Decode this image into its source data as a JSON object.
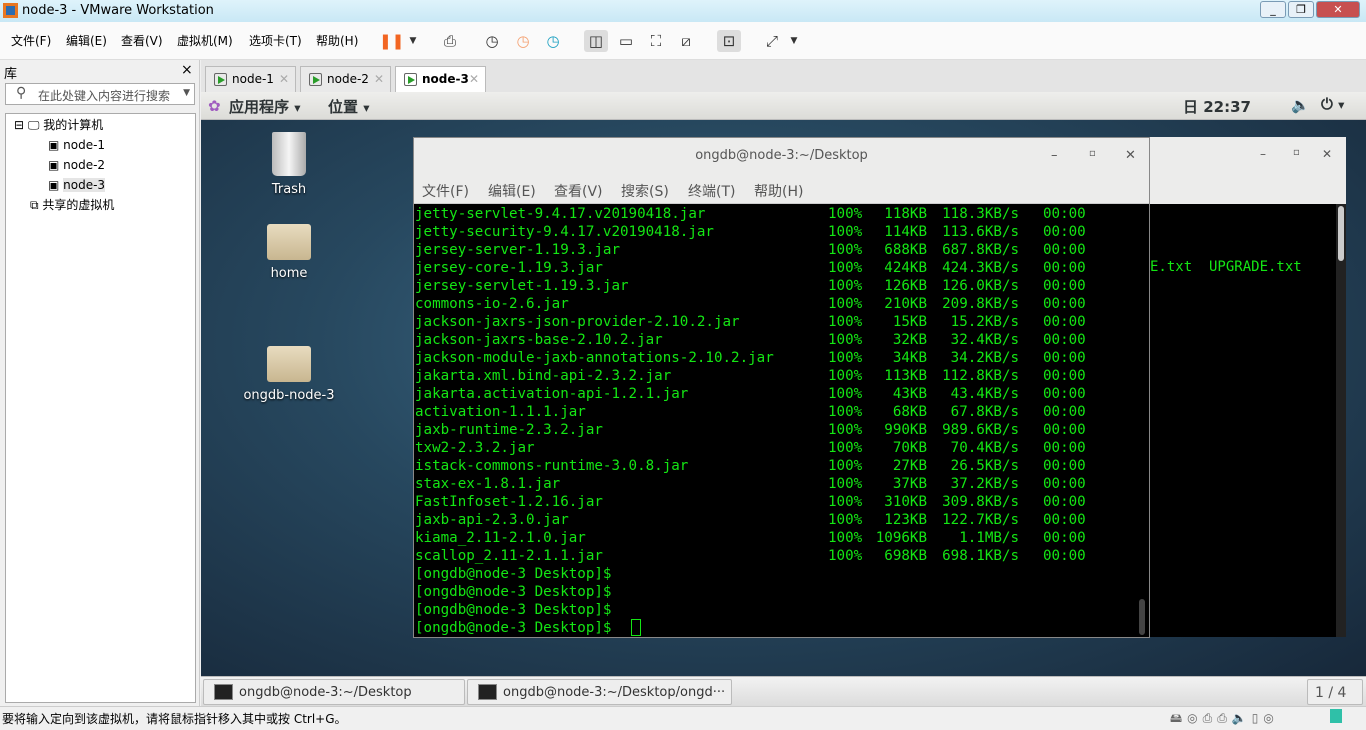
{
  "window": {
    "title": "node-3 - VMware Workstation"
  },
  "menubar": {
    "items": [
      "文件(F)",
      "编辑(E)",
      "查看(V)",
      "虚拟机(M)",
      "选项卡(T)",
      "帮助(H)"
    ]
  },
  "library": {
    "title": "库",
    "close": "×",
    "search_placeholder": "在此处键入内容进行搜索",
    "tree": {
      "root": "我的计算机",
      "vms": [
        "node-1",
        "node-2",
        "node-3"
      ],
      "shared": "共享的虚拟机"
    }
  },
  "vm_tabs": [
    {
      "label": "node-1"
    },
    {
      "label": "node-2"
    },
    {
      "label": "node-3",
      "active": true
    }
  ],
  "gnome": {
    "apps": "应用程序",
    "places": "位置",
    "clock": "日 22:37"
  },
  "desktop": {
    "icons": [
      "Trash",
      "home",
      "ongdb-node-3"
    ]
  },
  "terminal": {
    "title": "ongdb@node-3:~/Desktop",
    "menu": [
      "文件(F)",
      "编辑(E)",
      "查看(V)",
      "搜索(S)",
      "终端(T)",
      "帮助(H)"
    ],
    "transfers": [
      [
        "jetty-servlet-9.4.17.v20190418.jar",
        "100%",
        "118KB",
        "118.3KB/s",
        "00:00"
      ],
      [
        "jetty-security-9.4.17.v20190418.jar",
        "100%",
        "114KB",
        "113.6KB/s",
        "00:00"
      ],
      [
        "jersey-server-1.19.3.jar",
        "100%",
        "688KB",
        "687.8KB/s",
        "00:00"
      ],
      [
        "jersey-core-1.19.3.jar",
        "100%",
        "424KB",
        "424.3KB/s",
        "00:00"
      ],
      [
        "jersey-servlet-1.19.3.jar",
        "100%",
        "126KB",
        "126.0KB/s",
        "00:00"
      ],
      [
        "commons-io-2.6.jar",
        "100%",
        "210KB",
        "209.8KB/s",
        "00:00"
      ],
      [
        "jackson-jaxrs-json-provider-2.10.2.jar",
        "100%",
        "15KB",
        "15.2KB/s",
        "00:00"
      ],
      [
        "jackson-jaxrs-base-2.10.2.jar",
        "100%",
        "32KB",
        "32.4KB/s",
        "00:00"
      ],
      [
        "jackson-module-jaxb-annotations-2.10.2.jar",
        "100%",
        "34KB",
        "34.2KB/s",
        "00:00"
      ],
      [
        "jakarta.xml.bind-api-2.3.2.jar",
        "100%",
        "113KB",
        "112.8KB/s",
        "00:00"
      ],
      [
        "jakarta.activation-api-1.2.1.jar",
        "100%",
        "43KB",
        "43.4KB/s",
        "00:00"
      ],
      [
        "activation-1.1.1.jar",
        "100%",
        "68KB",
        "67.8KB/s",
        "00:00"
      ],
      [
        "jaxb-runtime-2.3.2.jar",
        "100%",
        "990KB",
        "989.6KB/s",
        "00:00"
      ],
      [
        "txw2-2.3.2.jar",
        "100%",
        "70KB",
        "70.4KB/s",
        "00:00"
      ],
      [
        "istack-commons-runtime-3.0.8.jar",
        "100%",
        "27KB",
        "26.5KB/s",
        "00:00"
      ],
      [
        "stax-ex-1.8.1.jar",
        "100%",
        "37KB",
        "37.2KB/s",
        "00:00"
      ],
      [
        "FastInfoset-1.2.16.jar",
        "100%",
        "310KB",
        "309.8KB/s",
        "00:00"
      ],
      [
        "jaxb-api-2.3.0.jar",
        "100%",
        "123KB",
        "122.7KB/s",
        "00:00"
      ],
      [
        "kiama_2.11-2.1.0.jar",
        "100%",
        "1096KB",
        "1.1MB/s",
        "00:00"
      ],
      [
        "scallop_2.11-2.1.1.jar",
        "100%",
        "698KB",
        "698.1KB/s",
        "00:00"
      ]
    ],
    "prompts": [
      "[ongdb@node-3 Desktop]$",
      "[ongdb@node-3 Desktop]$",
      "[ongdb@node-3 Desktop]$",
      "[ongdb@node-3 Desktop]$"
    ]
  },
  "background_terminal": {
    "visible_text": "E.txt  UPGRADE.txt"
  },
  "taskbar": {
    "tasks": [
      "ongdb@node-3:~/Desktop",
      "ongdb@node-3:~/Desktop/ongd···"
    ],
    "workspace": "1 / 4"
  },
  "statusbar": {
    "message": "要将输入定向到该虚拟机，请将鼠标指针移入其中或按 Ctrl+G。"
  },
  "colors": {
    "terminal_fg": "#14e614",
    "pause_accent": "#f26522"
  }
}
